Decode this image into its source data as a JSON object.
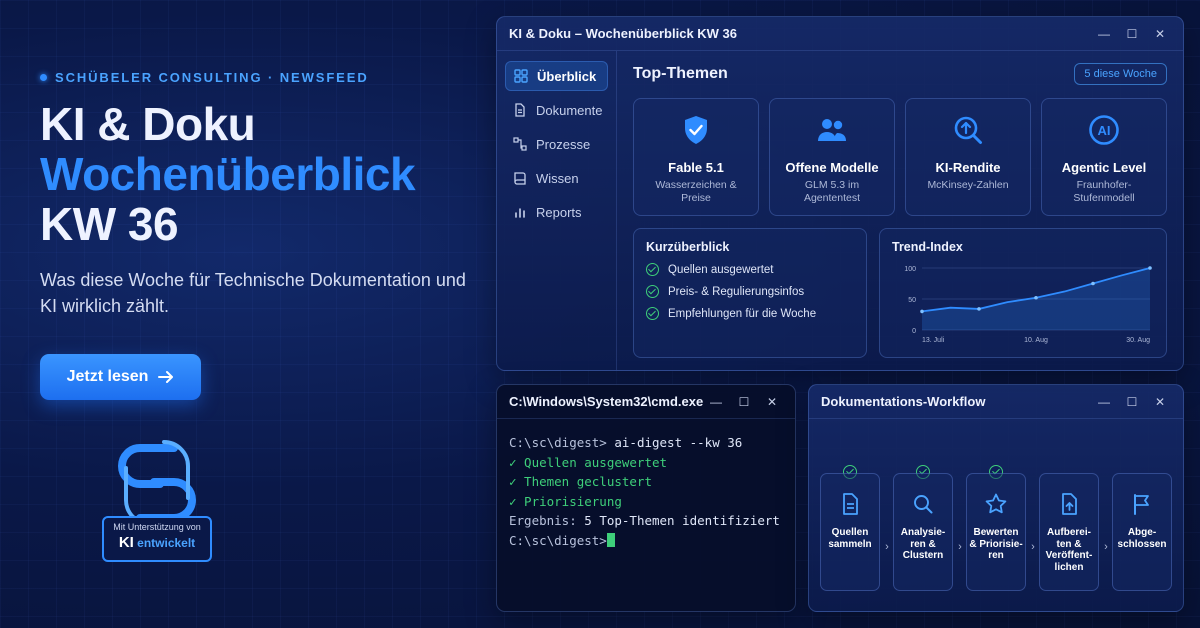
{
  "hero": {
    "eyebrow": "SCHÜBELER CONSULTING · NEWSFEED",
    "title_line1": "KI & Doku",
    "title_line2": "Wochenüberblick",
    "title_line3": "KW 36",
    "subtitle": "Was diese Woche für Technische Dokumentation und KI wirklich zählt.",
    "cta_label": "Jetzt lesen",
    "logo_line1": "Mit Unterstützung von",
    "logo_line2_a": "KI",
    "logo_line2_b": "entwickelt"
  },
  "main_window": {
    "title": "KI & Doku – Wochenüberblick KW 36",
    "sidebar": [
      {
        "label": "Überblick",
        "icon": "grid-icon",
        "active": true
      },
      {
        "label": "Dokumente",
        "icon": "document-icon",
        "active": false
      },
      {
        "label": "Prozesse",
        "icon": "process-icon",
        "active": false
      },
      {
        "label": "Wissen",
        "icon": "book-icon",
        "active": false
      },
      {
        "label": "Reports",
        "icon": "bar-chart-icon",
        "active": false
      }
    ],
    "section_title": "Top-Themen",
    "badge": "5 diese Woche",
    "topics": [
      {
        "title": "Fable 5.1",
        "subtitle": "Wasserzeichen & Preise",
        "icon": "shield-check-icon"
      },
      {
        "title": "Offene Modelle",
        "subtitle": "GLM 5.3 im Agententest",
        "icon": "users-icon"
      },
      {
        "title": "KI-Rendite",
        "subtitle": "McKinsey-Zahlen",
        "icon": "magnifier-growth-icon"
      },
      {
        "title": "Agentic Level",
        "subtitle": "Fraunhofer-Stufenmodell",
        "icon": "ai-circle-icon"
      }
    ],
    "summary": {
      "title": "Kurzüberblick",
      "items": [
        "Quellen ausgewertet",
        "Preis- & Regulierungsinfos",
        "Empfehlungen für die Woche"
      ]
    }
  },
  "chart_data": {
    "type": "area",
    "title": "Trend-Index",
    "xlabel": "",
    "ylabel": "",
    "x_ticks": [
      "13. Juli",
      "10. Aug",
      "30. Aug"
    ],
    "y_ticks": [
      0,
      50,
      100
    ],
    "ylim": [
      0,
      100
    ],
    "series": [
      {
        "values": [
          30,
          36,
          34,
          45,
          52,
          62,
          75,
          88,
          100
        ]
      }
    ],
    "accent": "#2f8cff"
  },
  "terminal": {
    "title": "C:\\Windows\\System32\\cmd.exe",
    "prompt": "C:\\sc\\digest>",
    "command": "ai-digest --kw 36",
    "ok_lines": [
      "✓ Quellen ausgewertet",
      "✓ Themen geclustert",
      "✓ Priorisierung"
    ],
    "result_label": "Ergebnis:",
    "result_value": "5 Top-Themen identifiziert"
  },
  "workflow": {
    "title": "Dokumentations-Workflow",
    "steps": [
      {
        "label": "Quellen sammeln",
        "icon": "document-icon",
        "done": true
      },
      {
        "label": "Analysie-ren & Clustern",
        "icon": "search-icon",
        "done": true
      },
      {
        "label": "Bewerten & Priorisie-ren",
        "icon": "star-icon",
        "done": true
      },
      {
        "label": "Aufberei-ten & Veröffent-lichen",
        "icon": "upload-file-icon",
        "done": false
      },
      {
        "label": "Abge-schlossen",
        "icon": "flag-icon",
        "done": false
      }
    ]
  },
  "colors": {
    "accent": "#2f8cff",
    "success": "#3ecf7a",
    "background": "#0a1848"
  }
}
